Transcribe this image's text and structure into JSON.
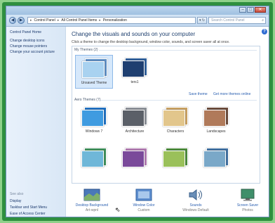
{
  "window": {
    "buttons": {
      "minimize": "–",
      "maximize": "□",
      "close": "✕"
    }
  },
  "toolbar": {
    "back": "◀",
    "forward": "▶",
    "breadcrumbs": [
      "Control Panel",
      "All Control Panel Items",
      "Personalization"
    ],
    "separator": "▸",
    "refresh": "▾ ↻",
    "search_placeholder": "Search Control Panel",
    "search_icon": "⌕"
  },
  "sidebar": {
    "items": [
      {
        "label": "Control Panel Home"
      },
      {
        "label": "Change desktop icons"
      },
      {
        "label": "Change mouse pointers"
      },
      {
        "label": "Change your account picture"
      }
    ],
    "see_also": "See also",
    "bottom_items": [
      {
        "label": "Display"
      },
      {
        "label": "Taskbar and Start Menu"
      },
      {
        "label": "Ease of Access Center"
      }
    ]
  },
  "main": {
    "help": "?",
    "heading": "Change the visuals and sounds on your computer",
    "subtext": "Click a theme to change the desktop background, window color, sounds, and screen saver all at once.",
    "my_themes_label": "My Themes (2)",
    "my_themes": [
      {
        "name": "Unsaved Theme",
        "selected": true,
        "back": "#5e8fc4",
        "front": "#a9d2f0"
      },
      {
        "name": "ters1",
        "selected": false,
        "back": "#2f5f9a",
        "front": "#1f3f70"
      }
    ],
    "save_theme": "Save theme",
    "get_more": "Get more themes online",
    "aero_label": "Aero Themes (7)",
    "aero_themes": [
      {
        "name": "Windows 7",
        "back": "#1e6fc0",
        "front": "#3f9be0"
      },
      {
        "name": "Architecture",
        "back": "#8a8f96",
        "front": "#5b6068"
      },
      {
        "name": "Characters",
        "back": "#c8a060",
        "front": "#e2c68c"
      },
      {
        "name": "Landscapes",
        "back": "#6a4a3a",
        "front": "#b07a5a"
      }
    ],
    "nature_themes": [
      {
        "back": "#3f8f5a",
        "front": "#6fb7d8"
      },
      {
        "back": "#b07ab0",
        "front": "#7a4a9a"
      },
      {
        "back": "#4a8a3a",
        "front": "#9ac05a"
      },
      {
        "back": "#3f6fa0",
        "front": "#7aa8c8"
      }
    ]
  },
  "options": [
    {
      "label": "Desktop Background",
      "value": "Art-wpnl",
      "icon": "desktop-background-icon"
    },
    {
      "label": "Window Color",
      "value": "Custom",
      "icon": "window-color-icon"
    },
    {
      "label": "Sounds",
      "value": "Windows Default",
      "icon": "sounds-icon"
    },
    {
      "label": "Screen Saver",
      "value": "Photos",
      "icon": "screen-saver-icon"
    }
  ],
  "cursor": "⇖"
}
